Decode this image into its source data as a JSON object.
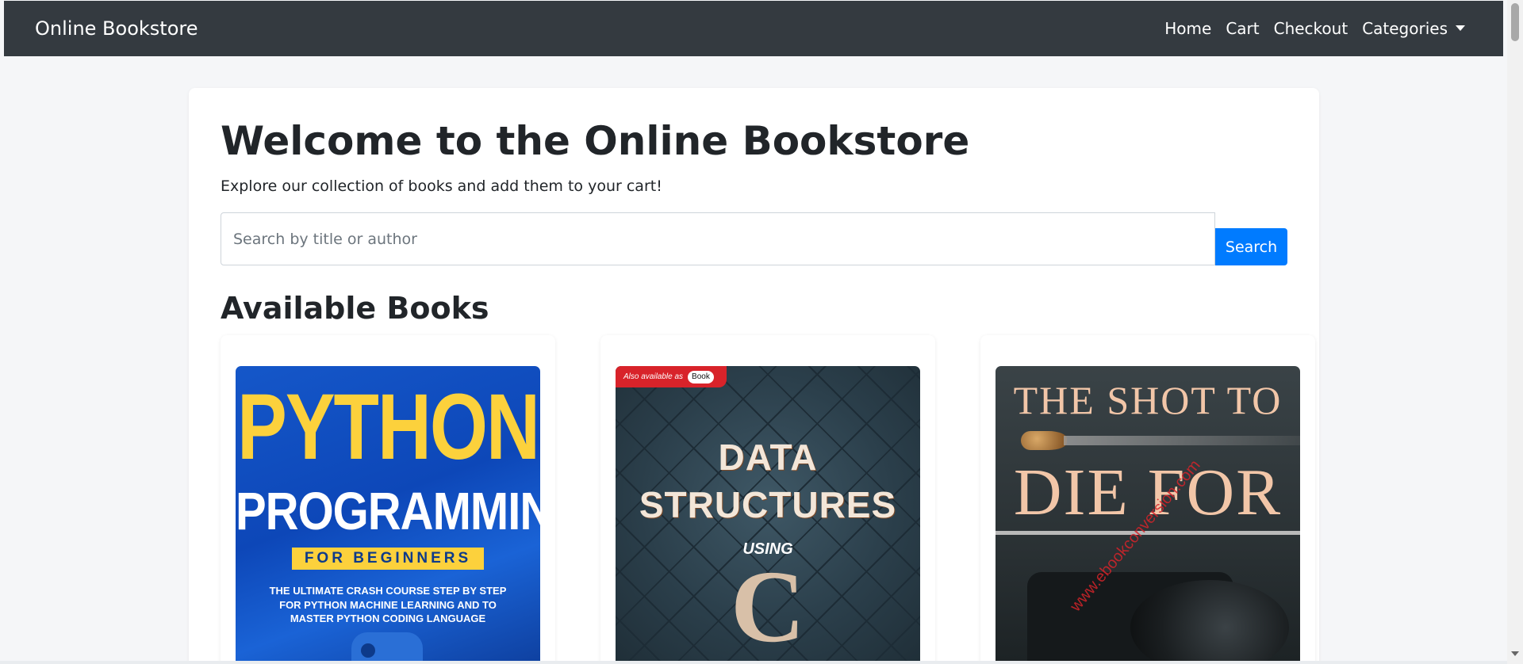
{
  "navbar": {
    "brand": "Online Bookstore",
    "links": [
      "Home",
      "Cart",
      "Checkout",
      "Categories"
    ]
  },
  "hero": {
    "title": "Welcome to the Online Bookstore",
    "lead": "Explore our collection of books and add them to your cart!"
  },
  "search": {
    "placeholder": "Search by title or author",
    "button_label": "Search"
  },
  "books_section": {
    "title": "Available Books",
    "books": [
      {
        "cover_lines": [
          "PYTHON",
          "PROGRAMMING",
          "FOR BEGINNERS",
          "THE ULTIMATE CRASH COURSE STEP BY STEP FOR PYTHON MACHINE LEARNING AND TO MASTER PYTHON CODING LANGUAGE"
        ]
      },
      {
        "cover_tag": "Also available as",
        "cover_tag_badge": "Book",
        "cover_lines": [
          "DATA",
          "STRUCTURES",
          "USING",
          "C"
        ]
      },
      {
        "cover_lines": [
          "THE SHOT TO",
          "DIE FOR"
        ],
        "watermark": "www.ebookconversion.com"
      }
    ]
  },
  "colors": {
    "navbar_bg": "#343a40",
    "primary": "#007bff",
    "page_bg": "#f5f6f8"
  }
}
